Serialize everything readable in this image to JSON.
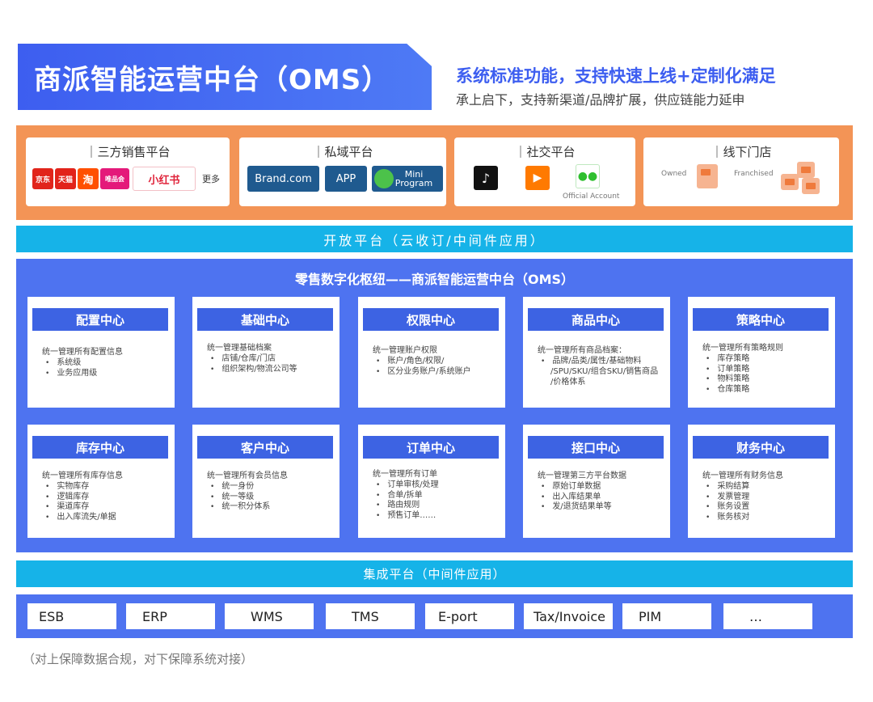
{
  "header": {
    "title": "商派智能运营中台（OMS）",
    "slogan": "系统标准功能，支持快速上线+定制化满足",
    "subslogan": "承上启下，支持新渠道/品牌扩展，供应链能力延申"
  },
  "channels": {
    "third_party": {
      "title": "三方销售平台",
      "logos": [
        "京东",
        "天猫",
        "淘",
        "唯品会",
        "小红书"
      ],
      "more": "更多"
    },
    "private": {
      "title": "私域平台",
      "buttons": [
        "Brand.com",
        "APP",
        "Mini Program"
      ]
    },
    "social": {
      "title": "社交平台",
      "caption": "Official Account"
    },
    "offline": {
      "title": "线下门店",
      "owned": "Owned",
      "franchised": "Franchised"
    }
  },
  "open_platform": "开放平台（云收订/中间件应用）",
  "oms": {
    "heading": "零售数字化枢纽——商派智能运营中台（OMS）",
    "modules": [
      {
        "title": "配置中心",
        "intro": "统一管理所有配置信息",
        "items": [
          "系统级",
          "业务应用级"
        ]
      },
      {
        "title": "基础中心",
        "intro": "统一管理基础档案",
        "items": [
          "店铺/仓库/门店",
          "组织架构/物流公司等"
        ]
      },
      {
        "title": "权限中心",
        "intro": "统一管理账户权限",
        "items": [
          "账户/角色/权限/",
          "区分业务账户/系统账户"
        ]
      },
      {
        "title": "商品中心",
        "intro": "统一管理所有商品档案：",
        "items": [
          "品牌/品类/属性/基础物料"
        ],
        "extra": [
          "/SPU/SKU/组合SKU/销售商品",
          "/价格体系"
        ]
      },
      {
        "title": "策略中心",
        "intro": "统一管理所有策略规则",
        "items": [
          "库存策略",
          "订单策略",
          "物料策略",
          "仓库策略"
        ]
      },
      {
        "title": "库存中心",
        "intro": "统一管理所有库存信息",
        "items": [
          "实物库存",
          "逻辑库存",
          "渠道库存",
          "出入库流失/单据"
        ]
      },
      {
        "title": "客户中心",
        "intro": "统一管理所有会员信息",
        "items": [
          "统一身份",
          "统一等级",
          "统一积分体系"
        ]
      },
      {
        "title": "订单中心",
        "intro": "统一管理所有订单",
        "items": [
          "订单审核/处理",
          "合单/拆单",
          "路由规则",
          "预售订单……"
        ]
      },
      {
        "title": "接口中心",
        "intro": "统一管理第三方平台数据",
        "items": [
          "原始订单数据",
          "出入库结果单",
          "发/退货结果单等"
        ]
      },
      {
        "title": "财务中心",
        "intro": "统一管理所有财务信息",
        "items": [
          "采购结算",
          "发票管理",
          "账务设置",
          "账务核对"
        ]
      }
    ]
  },
  "integration_platform": "集成平台（中间件应用）",
  "systems": [
    "ESB",
    "ERP",
    "WMS",
    "TMS",
    "E-port",
    "Tax/Invoice",
    "PIM",
    "…"
  ],
  "footnote": "（对上保障数据合规，对下保障系统对接）",
  "colors": {
    "primary_blue": "#3d5ef0",
    "panel_blue": "#4e73f0",
    "orange": "#f39456",
    "cyan": "#16b3e8",
    "navy_button": "#1f5a8f"
  }
}
